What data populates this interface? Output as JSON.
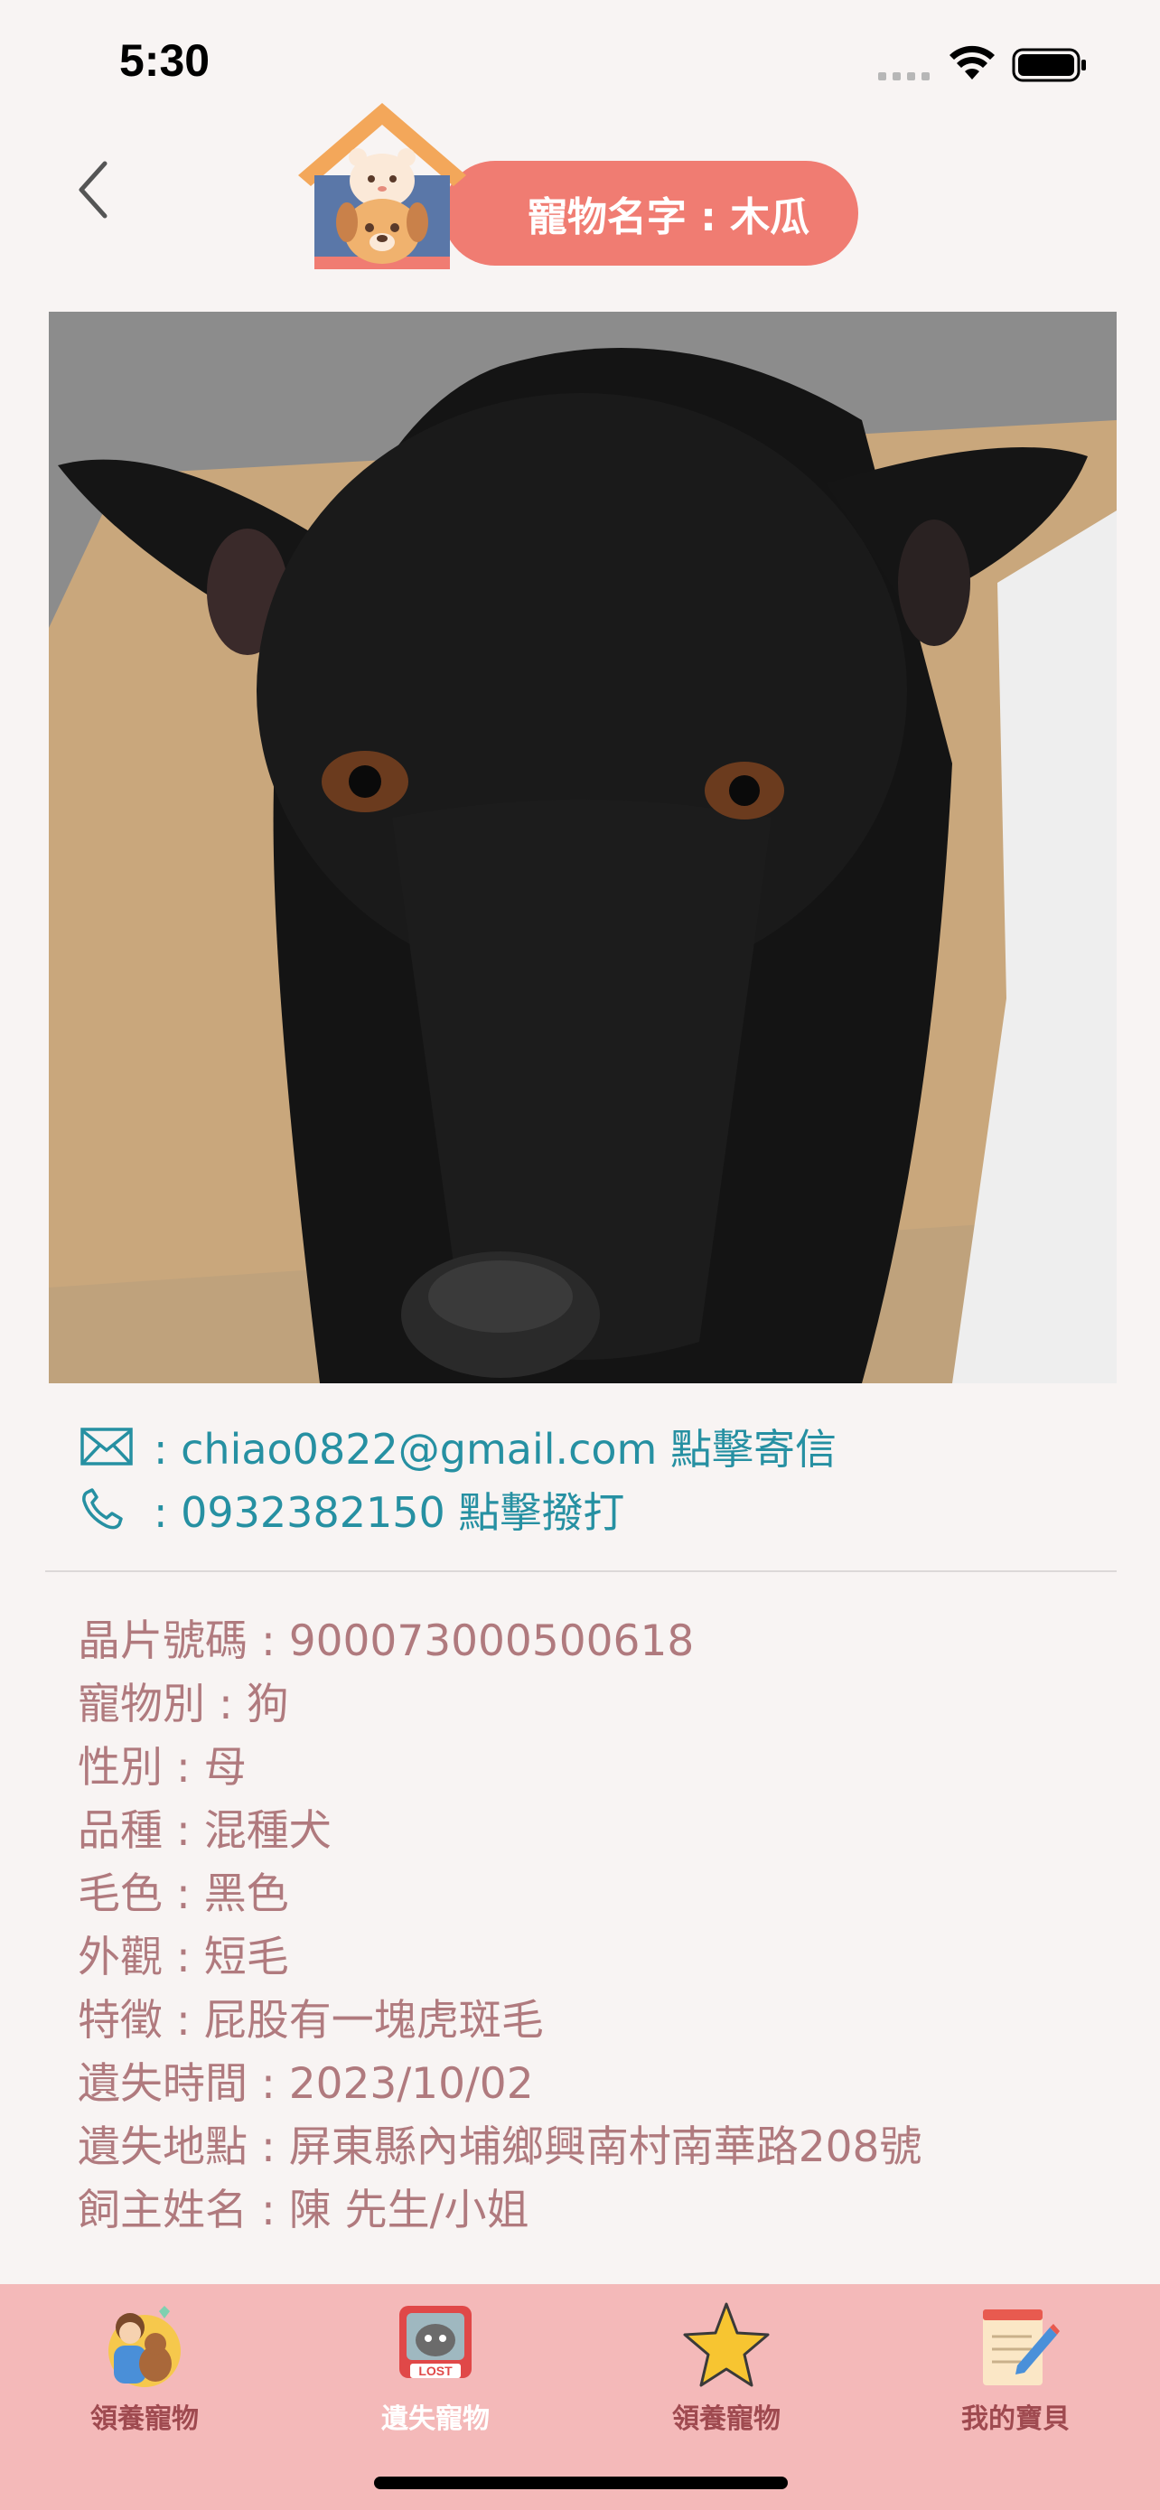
{
  "status_bar": {
    "time": "5:30"
  },
  "header": {
    "pet_name_label": "寵物名字 : 木瓜",
    "back_icon": "chevron-left-icon",
    "logo_icon": "pet-house-logo",
    "pill_color": "#f07c72"
  },
  "photo": {
    "description_icon": "black-dog-photo"
  },
  "contact": {
    "email_text": ": chiao0822@gmail.com 點擊寄信",
    "phone_text": ": 0932382150 點擊撥打",
    "email_icon": "mail-icon",
    "phone_icon": "phone-icon",
    "link_color": "#2690a2"
  },
  "info": {
    "lines": [
      "晶片號碼 : 900073000500618",
      "寵物別 : 狗",
      "性別 : 母",
      "品種 : 混種犬",
      "毛色 : 黑色",
      "外觀 : 短毛",
      "特徵 : 屁股有一塊虎斑毛",
      "遺失時間 : 2023/10/02",
      "遺失地點 : 屏東縣內埔鄉興南村南華路208號",
      "飼主姓名 : 陳 先生/小姐"
    ],
    "text_color": "#b07a7e"
  },
  "tab_bar": {
    "background": "#f4b9b9",
    "tabs": [
      {
        "label": "領養寵物",
        "icon": "adopt-pets-icon",
        "active": false
      },
      {
        "label": "遺失寵物",
        "icon": "lost-pet-icon",
        "active": true
      },
      {
        "label": "領養寵物",
        "icon": "star-icon",
        "active": false
      },
      {
        "label": "我的寶貝",
        "icon": "notepad-icon",
        "active": false
      }
    ]
  }
}
